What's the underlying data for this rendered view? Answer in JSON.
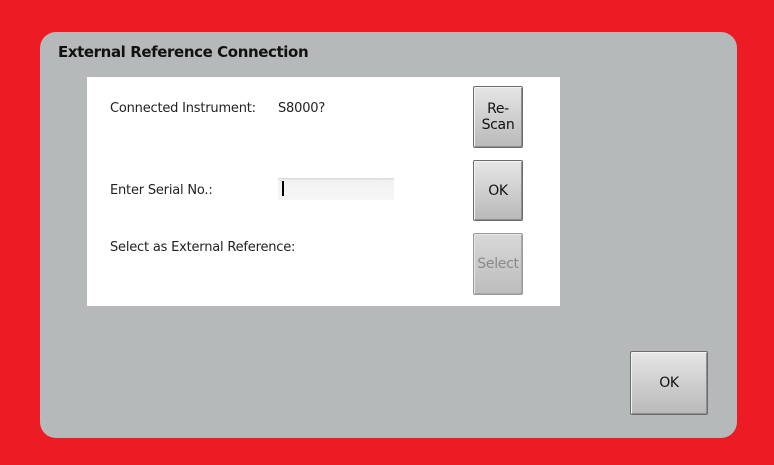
{
  "window": {
    "title": "External Reference Connection"
  },
  "panel": {
    "connected_label": "Connected Instrument:",
    "connected_value": "S8000?",
    "serial_label": "Enter Serial No.:",
    "serial_value": "",
    "select_label": "Select as External Reference:"
  },
  "buttons": {
    "rescan": "Re-Scan",
    "ok_serial": "OK",
    "select": "Select",
    "ok_main": "OK"
  },
  "colors": {
    "background": "#ed1c24",
    "dialog": "#b6b9b9",
    "panel": "#ffffff"
  }
}
